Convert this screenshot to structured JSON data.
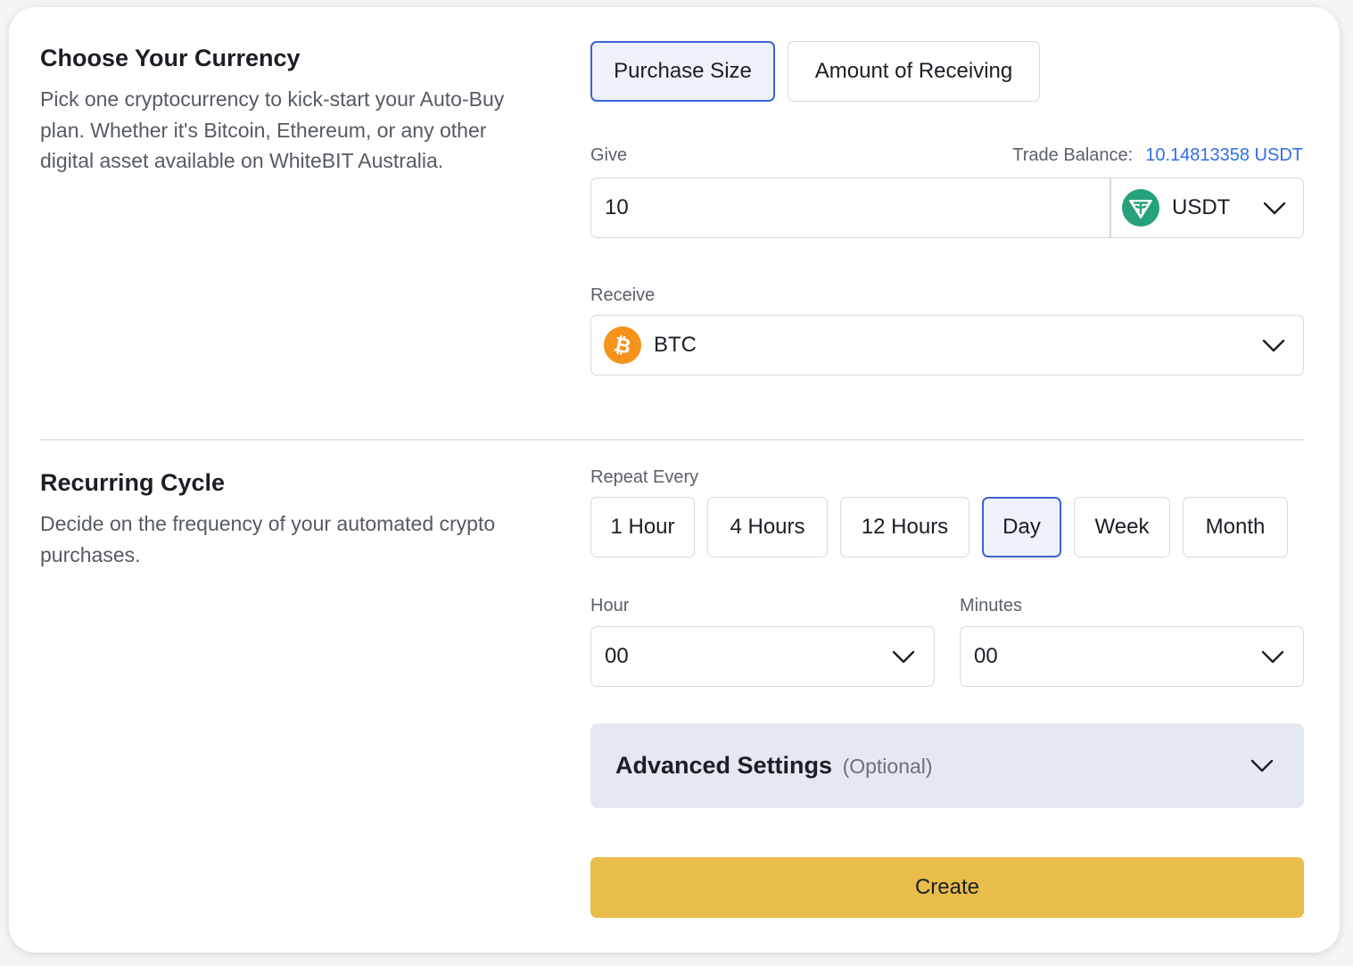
{
  "currency_section": {
    "title": "Choose Your Currency",
    "description": "Pick one cryptocurrency to kick-start your Auto-Buy plan. Whether it's Bitcoin, Ethereum, or any other digital asset available on WhiteBIT Australia."
  },
  "mode_toggle": {
    "purchase_size_label": "Purchase Size",
    "amount_receiving_label": "Amount of Receiving",
    "selected": "Purchase Size"
  },
  "give": {
    "label": "Give",
    "balance_label": "Trade Balance:",
    "balance_value": "10.14813358 USDT",
    "amount": "10",
    "currency": "USDT",
    "currency_icon": "tether-icon"
  },
  "receive": {
    "label": "Receive",
    "currency": "BTC",
    "currency_icon": "bitcoin-icon"
  },
  "recurring_section": {
    "title": "Recurring Cycle",
    "description": "Decide on the frequency of your automated crypto purchases."
  },
  "repeat": {
    "label": "Repeat Every",
    "options": [
      "1 Hour",
      "4 Hours",
      "12 Hours",
      "Day",
      "Week",
      "Month"
    ],
    "selected": "Day"
  },
  "time": {
    "hour_label": "Hour",
    "hour_value": "00",
    "minutes_label": "Minutes",
    "minutes_value": "00"
  },
  "advanced": {
    "title": "Advanced Settings",
    "optional": "(Optional)"
  },
  "create_label": "Create",
  "colors": {
    "accent_blue": "#3b63d6",
    "balance_link": "#2f6fe4",
    "create_button": "#e9bd4b",
    "advanced_bg": "#e3e8f1",
    "tether": "#26a17b",
    "bitcoin": "#f7931a"
  }
}
